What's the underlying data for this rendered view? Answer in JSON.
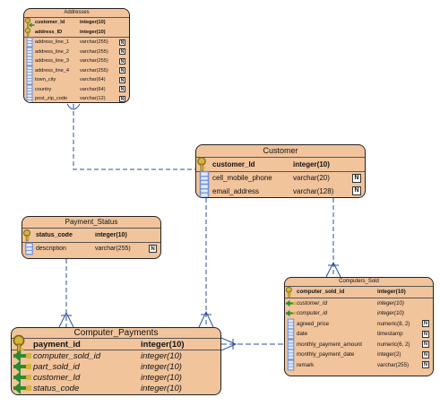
{
  "tables": {
    "addresses": {
      "title": "Addresses",
      "pk_rows": [
        {
          "name": "customer_Id",
          "type": "integer(10)",
          "kind": "pk-fk",
          "nullable": ""
        },
        {
          "name": "address_ID",
          "type": "integer(10)",
          "kind": "pk",
          "nullable": ""
        }
      ],
      "rows": [
        {
          "name": "address_line_1",
          "type": "varchar(255)",
          "kind": "attr",
          "nullable": "N"
        },
        {
          "name": "address_line_2",
          "type": "varchar(255)",
          "kind": "attr",
          "nullable": "N"
        },
        {
          "name": "address_line_3",
          "type": "varchar(255)",
          "kind": "attr",
          "nullable": "N"
        },
        {
          "name": "address_line_4",
          "type": "varchar(255)",
          "kind": "attr",
          "nullable": "N"
        },
        {
          "name": "town_city",
          "type": "varchar(64)",
          "kind": "attr",
          "nullable": "N"
        },
        {
          "name": "country",
          "type": "varchar(64)",
          "kind": "attr",
          "nullable": "N"
        },
        {
          "name": "post_zip_code",
          "type": "varchar(12)",
          "kind": "attr",
          "nullable": "N"
        }
      ]
    },
    "customer": {
      "title": "Customer",
      "pk_rows": [
        {
          "name": "customer_Id",
          "type": "integer(10)",
          "kind": "pk",
          "nullable": ""
        }
      ],
      "rows": [
        {
          "name": "cell_mobile_phone",
          "type": "varchar(20)",
          "kind": "attr",
          "nullable": "N"
        },
        {
          "name": "email_address",
          "type": "varchar(128)",
          "kind": "attr",
          "nullable": "N"
        }
      ]
    },
    "payment_status": {
      "title": "Payment_Status",
      "pk_rows": [
        {
          "name": "status_code",
          "type": "integer(10)",
          "kind": "pk",
          "nullable": ""
        }
      ],
      "rows": [
        {
          "name": "description",
          "type": "varchar(255)",
          "kind": "attr",
          "nullable": "N"
        }
      ]
    },
    "computers_sold": {
      "title": "Computers_Sold",
      "pk_rows": [
        {
          "name": "computer_sold_id",
          "type": "integer(10)",
          "kind": "pk",
          "nullable": ""
        }
      ],
      "rows": [
        {
          "name": "customer_Id",
          "type": "integer(10)",
          "kind": "fk",
          "nullable": ""
        },
        {
          "name": "computer_id",
          "type": "integer(10)",
          "kind": "fk",
          "nullable": ""
        },
        {
          "name": "agreed_price",
          "type": "numeric(8, 2)",
          "kind": "attr",
          "nullable": "N"
        },
        {
          "name": "date",
          "type": "timestamp",
          "kind": "attr",
          "nullable": "N"
        },
        {
          "name": "monthly_payment_amount",
          "type": "numeric(6, 2)",
          "kind": "attr",
          "nullable": "N"
        },
        {
          "name": "monthly_payment_date",
          "type": "integer(2)",
          "kind": "attr",
          "nullable": "N"
        },
        {
          "name": "remark",
          "type": "varchar(255)",
          "kind": "attr",
          "nullable": "N"
        }
      ]
    },
    "computer_payments": {
      "title": "Computer_Payments",
      "pk_rows": [
        {
          "name": "payment_id",
          "type": "integer(10)",
          "kind": "pk",
          "nullable": ""
        }
      ],
      "rows": [
        {
          "name": "computer_sold_id",
          "type": "integer(10)",
          "kind": "fk",
          "nullable": ""
        },
        {
          "name": "part_sold_id",
          "type": "integer(10)",
          "kind": "fk",
          "nullable": ""
        },
        {
          "name": "customer_Id",
          "type": "integer(10)",
          "kind": "fk",
          "nullable": ""
        },
        {
          "name": "status_code",
          "type": "integer(10)",
          "kind": "fk",
          "nullable": ""
        }
      ]
    }
  },
  "icons": {
    "pk": "key-icon",
    "fk": "foreign-key-arrow-icon",
    "attr": "column-icon"
  },
  "colors": {
    "table_fill": "#f2c49c",
    "border": "#222222",
    "connector": "#2a4fa0",
    "key": "#d4b43a",
    "fk_arrow": "#2f8a2f",
    "column_icon": "#6f8fd0"
  }
}
